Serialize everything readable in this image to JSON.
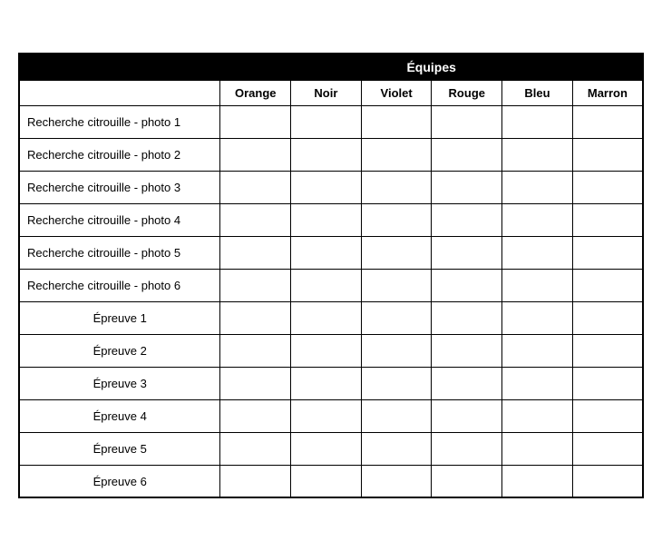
{
  "table": {
    "equipes_label": "Équipes",
    "team_columns": [
      "Orange",
      "Noir",
      "Violet",
      "Rouge",
      "Bleu",
      "Marron"
    ],
    "rows_search": [
      "Recherche citrouille - photo 1",
      "Recherche citrouille - photo 2",
      "Recherche citrouille - photo 3",
      "Recherche citrouille - photo 4",
      "Recherche citrouille - photo 5",
      "Recherche citrouille - photo 6"
    ],
    "rows_epreuve": [
      "Épreuve 1",
      "Épreuve 2",
      "Épreuve 3",
      "Épreuve 4",
      "Épreuve 5",
      "Épreuve 6"
    ]
  }
}
